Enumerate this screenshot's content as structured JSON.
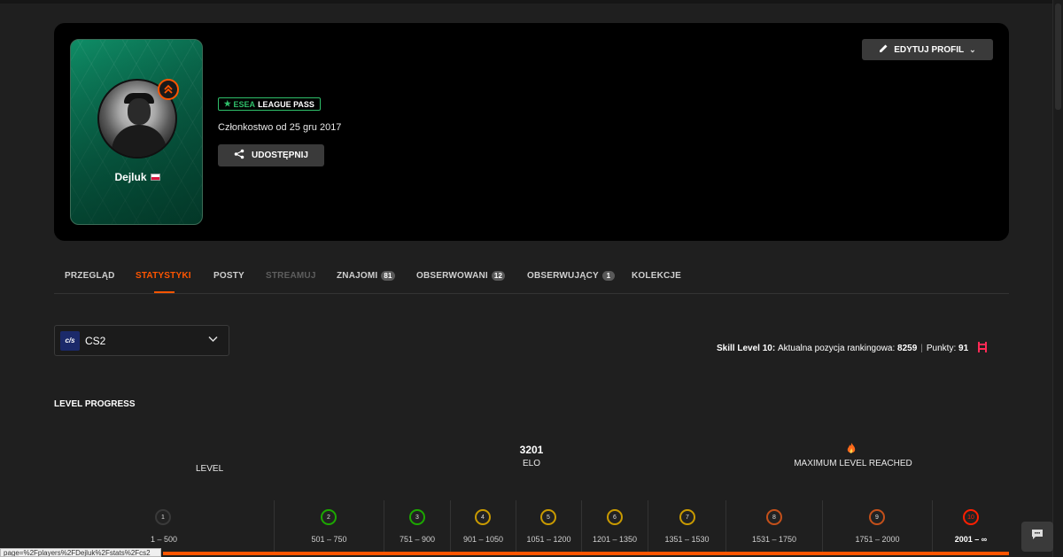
{
  "profile": {
    "nickname": "Dejluk",
    "country": "PL",
    "level_badge_icon": "chevron-up-double-icon",
    "pass_badge": {
      "prefix": "ESEA",
      "label": "LEAGUE PASS"
    },
    "member_since": "Członkostwo od 25 gru 2017",
    "share_label": "UDOSTĘPNIJ",
    "edit_label": "EDYTUJ PROFIL"
  },
  "tabs": [
    {
      "label": "PRZEGLĄD"
    },
    {
      "label": "STATYSTYKI",
      "active": true
    },
    {
      "label": "POSTY"
    },
    {
      "label": "STREAMUJ",
      "muted": true
    },
    {
      "label": "ZNAJOMI",
      "count": "81"
    },
    {
      "label": "OBSERWOWANI",
      "count": "12"
    },
    {
      "label": "OBSERWUJĄCY",
      "count": "1"
    },
    {
      "label": "KOLEKCJE"
    }
  ],
  "game_select": {
    "logo": "cs",
    "value": "CS2"
  },
  "skill": {
    "level_text": "Skill Level 10:",
    "ranking_label": "Aktualna pozycja rankingowa:",
    "ranking_value": "8259",
    "separator": "|",
    "points_label": "Punkty:",
    "points_value": "91"
  },
  "level_progress": {
    "title": "LEVEL PROGRESS",
    "level_label": "LEVEL",
    "elo_value": "3201",
    "elo_label": "ELO",
    "max_label": "MAXIMUM LEVEL REACHED",
    "levels": [
      {
        "level": "1",
        "range": "1 – 500",
        "color": "#bdbdbd"
      },
      {
        "level": "2",
        "range": "501 – 750",
        "color": "#1ce400"
      },
      {
        "level": "3",
        "range": "751 – 900",
        "color": "#1ce400"
      },
      {
        "level": "4",
        "range": "901 – 1050",
        "color": "#ffc800"
      },
      {
        "level": "5",
        "range": "1051 – 1200",
        "color": "#ffc800"
      },
      {
        "level": "6",
        "range": "1201 – 1350",
        "color": "#ffc800"
      },
      {
        "level": "7",
        "range": "1351 – 1530",
        "color": "#ffc800"
      },
      {
        "level": "8",
        "range": "1531 – 1750",
        "color": "#ff6309"
      },
      {
        "level": "9",
        "range": "1751 – 2000",
        "color": "#ff6309"
      },
      {
        "level": "10",
        "range": "2001 – ∞",
        "color": "#fe1f00",
        "current": true
      }
    ]
  },
  "status_url": "page=%2Fplayers%2FDejluk%2Fstats%2Fcs2",
  "colors": {
    "accent": "#ff5500",
    "background": "#1f1f1f",
    "banner": "#000000"
  }
}
